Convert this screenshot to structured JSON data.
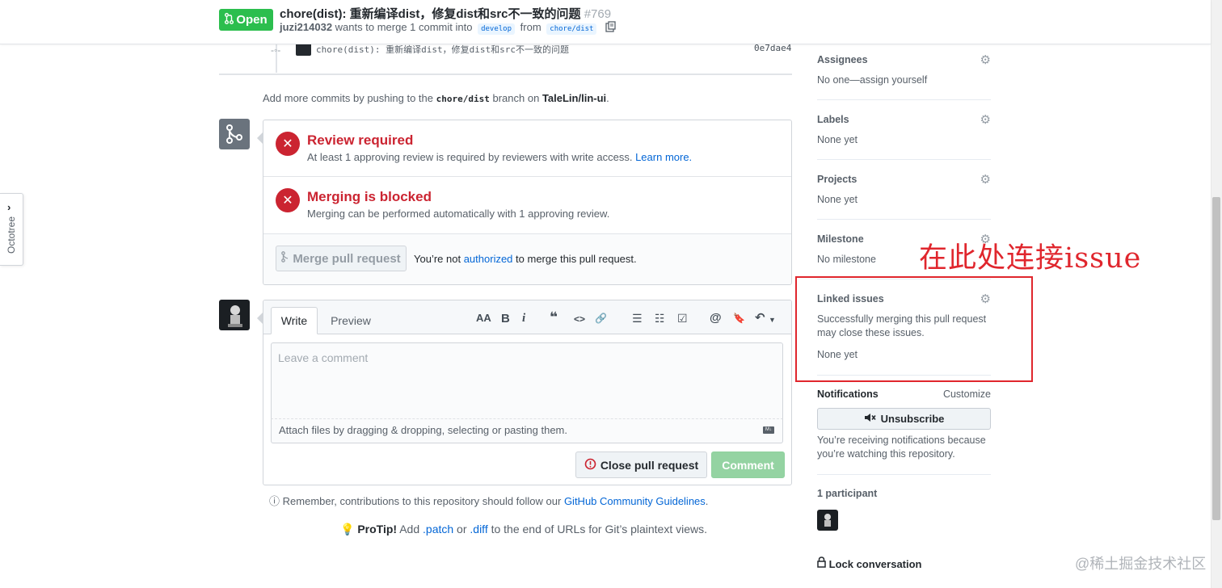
{
  "header": {
    "state": "Open",
    "title": "chore(dist): 重新编译dist，修复dist和src不一致的问题",
    "number": "#769",
    "author": "juzi214032",
    "meta_text": "wants to merge 1 commit into",
    "base_branch": "develop",
    "from_text": "from",
    "head_branch": "chore/dist"
  },
  "octotree": {
    "label": "Octotree"
  },
  "commit": {
    "message": "chore(dist): 重新编译dist，修复dist和src不一致的问题",
    "sha": "0e7dae4"
  },
  "push_hint": {
    "prefix": "Add more commits by pushing to the",
    "branch": "chore/dist",
    "middle": "branch on",
    "repo": "TaleLin/lin-ui",
    "suffix": "."
  },
  "merge": {
    "review_title": "Review required",
    "review_sub": "At least 1 approving review is required by reviewers with write access.",
    "learn_more": "Learn more.",
    "blocked_title": "Merging is blocked",
    "blocked_sub": "Merging can be performed automatically with 1 approving review.",
    "merge_button": "Merge pull request",
    "note_prefix": "You’re not",
    "note_link": "authorized",
    "note_suffix": "to merge this pull request."
  },
  "comment": {
    "tab_write": "Write",
    "tab_preview": "Preview",
    "placeholder": "Leave a comment",
    "attach": "Attach files by dragging & dropping, selecting or pasting them.",
    "close_button": "Close pull request",
    "comment_button": "Comment",
    "toolbar": {
      "heading": "AA",
      "bold": "B",
      "italic": "i",
      "quote": "❝",
      "code": "<>",
      "link": "🔗",
      "ul": "☰",
      "ol": "☷",
      "task": "☑",
      "mention": "@",
      "ref": "🔖",
      "reply": "↶"
    }
  },
  "guidelines": {
    "prefix": "Remember, contributions to this repository should follow our",
    "link": "GitHub Community Guidelines",
    "suffix": "."
  },
  "protip": {
    "label": "ProTip!",
    "text1": "Add",
    "patch": ".patch",
    "or": "or",
    "diff": ".diff",
    "text2": "to the end of URLs for Git’s plaintext views."
  },
  "sidebar": {
    "assignees": {
      "title": "Assignees",
      "value": "No one—assign yourself"
    },
    "labels": {
      "title": "Labels",
      "value": "None yet"
    },
    "projects": {
      "title": "Projects",
      "value": "None yet"
    },
    "milestone": {
      "title": "Milestone",
      "value": "No milestone"
    },
    "linked": {
      "title": "Linked issues",
      "desc1": "Successfully merging this pull request",
      "desc2": "may close these issues.",
      "value": "None yet"
    },
    "notifications": {
      "title": "Notifications",
      "customize": "Customize",
      "button": "Unsubscribe",
      "desc1": "You’re receiving notifications because",
      "desc2": "you’re watching this repository."
    },
    "participants": {
      "title": "1 participant"
    },
    "lock": "Lock conversation"
  },
  "annotation": {
    "text": "在此处连接issue",
    "color": "#e0262d"
  },
  "watermark": "@稀土掘金技术社区",
  "colors": {
    "open_green": "#2cbe4e",
    "blocked_red": "#cb2431",
    "link_blue": "#0366d6"
  }
}
